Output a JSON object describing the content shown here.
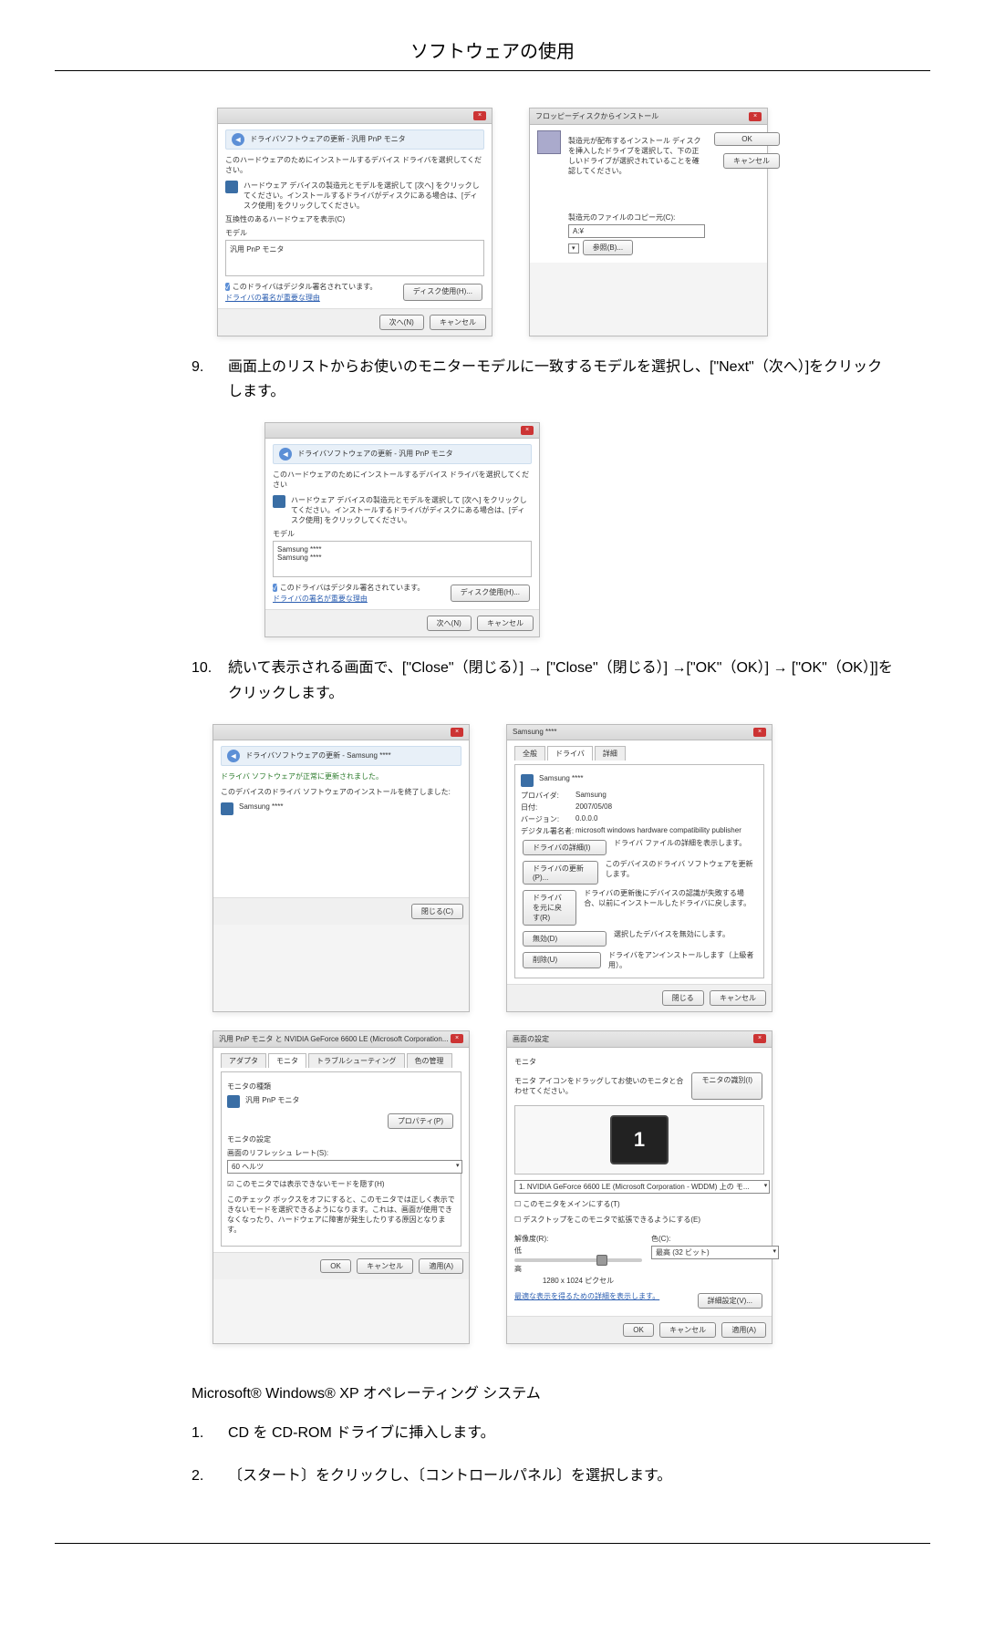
{
  "page_title": "ソフトウェアの使用",
  "steps": {
    "s9": {
      "num": "9.",
      "text": "画面上のリストからお使いのモニターモデルに一致するモデルを選択し、[\"Next\"（次へ）]をクリックします。"
    },
    "s10": {
      "num": "10.",
      "text": "続いて表示される画面で、[\"Close\"（閉じる）] → [\"Close\"（閉じる）] →[\"OK\"（OK）] → [\"OK\"（OK）]]をクリックします。"
    },
    "s1b": {
      "num": "1.",
      "text": "CD を CD-ROM ドライブに挿入します。"
    },
    "s2b": {
      "num": "2.",
      "text": "〔スタート〕をクリックし、〔コントロールパネル〕を選択します。"
    }
  },
  "os_heading": "Microsoft® Windows® XP オペレーティング システム",
  "dlg1": {
    "titlebar": "ドライバソフトウェアの更新 - 汎用 PnP モニタ",
    "instr": "このハードウェアのためにインストールするデバイス ドライバを選択してください。",
    "hint": "ハードウェア デバイスの製造元とモデルを選択して [次へ] をクリックしてください。インストールするドライバがディスクにある場合は、[ディスク使用] をクリックしてください。",
    "compat_label": "互換性のあるハードウェアを表示(C)",
    "list_header": "モデル",
    "list_item": "汎用 PnP モニタ",
    "signed_msg": "このドライバはデジタル署名されています。",
    "signed_link": "ドライバの署名が重要な理由",
    "disk_btn": "ディスク使用(H)...",
    "next_btn": "次へ(N)",
    "cancel_btn": "キャンセル"
  },
  "dlg2": {
    "titlebar": "フロッピーディスクからインストール",
    "instr": "製造元が配布するインストール ディスクを挿入したドライブを選択して、下の正しいドライブが選択されていることを確認してください。",
    "ok_btn": "OK",
    "cancel_btn": "キャンセル",
    "copy_label": "製造元のファイルのコピー元(C):",
    "path": "A:¥",
    "browse_btn": "参照(B)..."
  },
  "dlg3": {
    "titlebar": "ドライバソフトウェアの更新 - 汎用 PnP モニタ",
    "instr": "このハードウェアのためにインストールするデバイス ドライバを選択してください",
    "hint": "ハードウェア デバイスの製造元とモデルを選択して [次へ] をクリックしてください。インストールするドライバがディスクにある場合は、[ディスク使用] をクリックしてください。",
    "list_header": "モデル",
    "list_item1": "Samsung ****",
    "list_item2": "Samsung ****",
    "signed_msg": "このドライバはデジタル署名されています。",
    "signed_link": "ドライバの署名が重要な理由",
    "disk_btn": "ディスク使用(H)...",
    "next_btn": "次へ(N)",
    "cancel_btn": "キャンセル"
  },
  "dlg4": {
    "titlebar": "ドライバソフトウェアの更新 - Samsung ****",
    "done": "ドライバ ソフトウェアが正常に更新されました。",
    "done2": "このデバイスのドライバ ソフトウェアのインストールを終了しました:",
    "device": "Samsung ****",
    "close_btn": "閉じる(C)"
  },
  "dlg5": {
    "titlebar": "Samsung ****",
    "tab1": "全般",
    "tab2": "ドライバ",
    "tab3": "詳細",
    "device": "Samsung ****",
    "provider_label": "プロバイダ:",
    "provider_val": "Samsung",
    "date_label": "日付:",
    "date_val": "2007/05/08",
    "version_label": "バージョン:",
    "version_val": "0.0.0.0",
    "signer_label": "デジタル署名者:",
    "signer_val": "microsoft windows hardware compatibility publisher",
    "btn_detail": "ドライバの詳細(I)",
    "btn_detail_desc": "ドライバ ファイルの詳細を表示します。",
    "btn_update": "ドライバの更新(P)...",
    "btn_update_desc": "このデバイスのドライバ ソフトウェアを更新します。",
    "btn_rollback": "ドライバを元に戻す(R)",
    "btn_rollback_desc": "ドライバの更新後にデバイスの認識が失敗する場合、以前にインストールしたドライバに戻します。",
    "btn_disable": "無効(D)",
    "btn_disable_desc": "選択したデバイスを無効にします。",
    "btn_uninstall": "削除(U)",
    "btn_uninstall_desc": "ドライバをアンインストールします（上級者用）。",
    "close_btn": "閉じる",
    "cancel_btn": "キャンセル"
  },
  "dlg6": {
    "titlebar": "汎用 PnP モニタ と NVIDIA GeForce 6600 LE (Microsoft Corporation...",
    "tab1": "アダプタ",
    "tab2": "モニタ",
    "tab3": "トラブルシューティング",
    "tab4": "色の管理",
    "type_label": "モニタの種類",
    "type_val": "汎用 PnP モニタ",
    "prop_btn": "プロパティ(P)",
    "settings_label": "モニタの設定",
    "refresh_label": "画面のリフレッシュ レート(S):",
    "refresh_val": "60 ヘルツ",
    "hide_modes": "このモニタでは表示できないモードを隠す(H)",
    "hide_modes_desc": "このチェック ボックスをオフにすると、このモニタでは正しく表示できないモードを選択できるようになります。これは、画面が使用できなくなったり、ハードウェアに障害が発生したりする原因となります。",
    "ok_btn": "OK",
    "cancel_btn": "キャンセル",
    "apply_btn": "適用(A)"
  },
  "dlg7": {
    "titlebar": "画面の設定",
    "header": "モニタ",
    "drag_instr": "モニタ アイコンをドラッグしてお使いのモニタと合わせてください。",
    "identify_btn": "モニタの識別(I)",
    "preview_num": "1",
    "monitor_sel": "1. NVIDIA GeForce 6600 LE (Microsoft Corporation - WDDM) 上の モ...",
    "main_check": "このモニタをメインにする(T)",
    "extend_check": "デスクトップをこのモニタで拡張できるようにする(E)",
    "res_label": "解像度(R):",
    "res_low": "低",
    "res_high": "高",
    "color_label": "色(C):",
    "color_val": "最高 (32 ビット)",
    "res_val": "1280 x 1024 ピクセル",
    "how_link": "最適な表示を得るための詳細を表示します。",
    "adv_btn": "詳細設定(V)...",
    "ok_btn": "OK",
    "cancel_btn": "キャンセル",
    "apply_btn": "適用(A)"
  }
}
